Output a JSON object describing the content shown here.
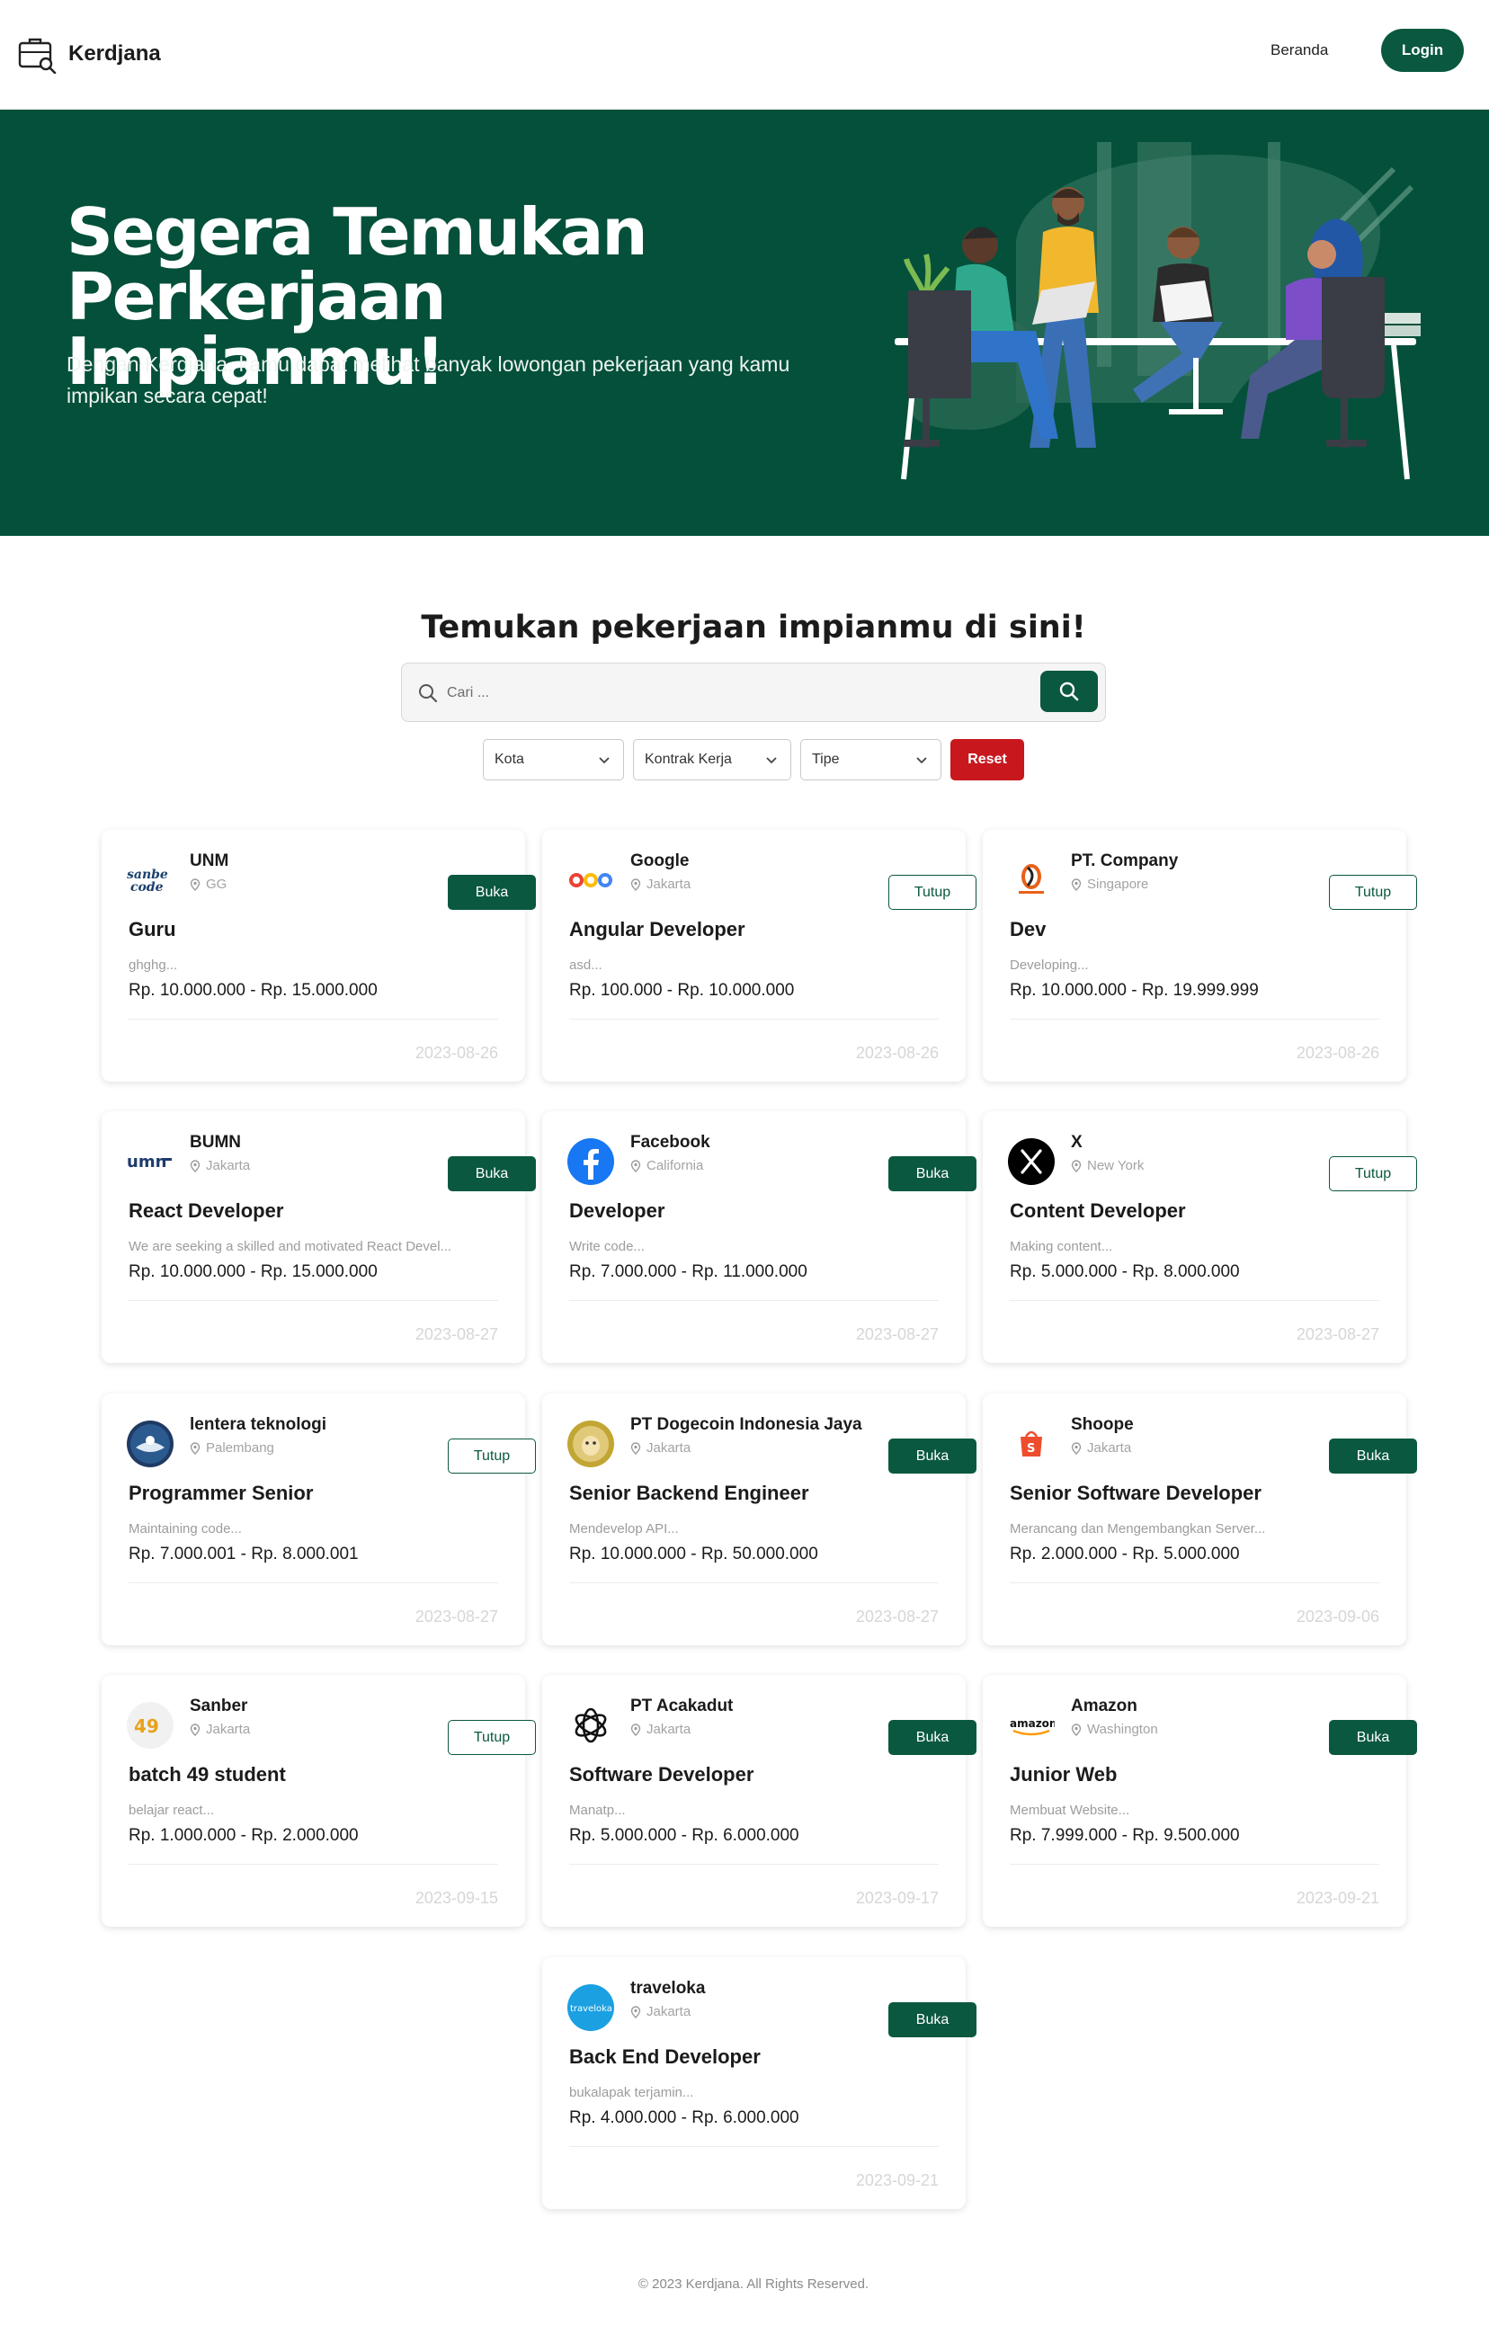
{
  "nav": {
    "brand": "Kerdjana",
    "home": "Beranda",
    "login": "Login"
  },
  "hero": {
    "title_line1": "Segera Temukan",
    "title_line2": "Perkerjaan Impianmu!",
    "subtitle": "Dengan Kerdjana, kamu dapat melihat banyak lowongan pekerjaan yang kamu impikan secara cepat!"
  },
  "search": {
    "heading": "Temukan pekerjaan impianmu di sini!",
    "placeholder": "Cari ...",
    "filters": [
      "Kota",
      "Kontrak Kerja",
      "Tipe"
    ],
    "reset": "Reset"
  },
  "colors": {
    "primary": "#0b5840",
    "hero_bg": "#04503a",
    "danger": "#c8181e"
  },
  "jobs": [
    {
      "company": "UNM",
      "location": "GG",
      "status": "Buka",
      "title": "Guru",
      "desc": "ghghg...",
      "salary": "Rp. 10.000.000 - Rp. 15.000.000",
      "date": "2023-08-26",
      "logo": "sanbercode-logo"
    },
    {
      "company": "Google",
      "location": "Jakarta",
      "status": "Tutup",
      "title": "Angular Developer",
      "desc": "asd...",
      "salary": "Rp. 100.000 - Rp. 10.000.000",
      "date": "2023-08-26",
      "logo": "google-logo"
    },
    {
      "company": "PT. Company",
      "location": "Singapore",
      "status": "Tutup",
      "title": "Dev",
      "desc": "Developing...",
      "salary": "Rp. 10.000.000 - Rp. 19.999.999",
      "date": "2023-08-26",
      "logo": "company-logo"
    },
    {
      "company": "BUMN",
      "location": "Jakarta",
      "status": "Buka",
      "title": "React Developer",
      "desc": "We are seeking a skilled and motivated React Devel...",
      "salary": "Rp. 10.000.000 - Rp. 15.000.000",
      "date": "2023-08-27",
      "logo": "umn-logo"
    },
    {
      "company": "Facebook",
      "location": "California",
      "status": "Buka",
      "title": "Developer",
      "desc": "Write code...",
      "salary": "Rp. 7.000.000 - Rp. 11.000.000",
      "date": "2023-08-27",
      "logo": "facebook-logo"
    },
    {
      "company": "X",
      "location": "New York",
      "status": "Tutup",
      "title": "Content Developer",
      "desc": "Making content...",
      "salary": "Rp. 5.000.000 - Rp. 8.000.000",
      "date": "2023-08-27",
      "logo": "x-logo"
    },
    {
      "company": "lentera teknologi",
      "location": "Palembang",
      "status": "Tutup",
      "title": "Programmer Senior",
      "desc": "Maintaining code...",
      "salary": "Rp. 7.000.001 - Rp. 8.000.001",
      "date": "2023-08-27",
      "logo": "lentera-logo"
    },
    {
      "company": "PT Dogecoin Indonesia Jaya",
      "location": "Jakarta",
      "status": "Buka",
      "title": "Senior Backend Engineer",
      "desc": "Mendevelop API...",
      "salary": "Rp. 10.000.000 - Rp. 50.000.000",
      "date": "2023-08-27",
      "logo": "dogecoin-logo"
    },
    {
      "company": "Shoope",
      "location": "Jakarta",
      "status": "Buka",
      "title": "Senior Software Developer",
      "desc": "Merancang dan Mengembangkan Server...",
      "salary": "Rp. 2.000.000 - Rp. 5.000.000",
      "date": "2023-09-06",
      "logo": "shopee-logo"
    },
    {
      "company": "Sanber",
      "location": "Jakarta",
      "status": "Tutup",
      "title": "batch 49 student",
      "desc": "belajar react...",
      "salary": "Rp. 1.000.000 - Rp. 2.000.000",
      "date": "2023-09-15",
      "logo": "sanber49-logo"
    },
    {
      "company": "PT Acakadut",
      "location": "Jakarta",
      "status": "Buka",
      "title": "Software Developer",
      "desc": "Manatp...",
      "salary": "Rp. 5.000.000 - Rp. 6.000.000",
      "date": "2023-09-17",
      "logo": "openai-logo"
    },
    {
      "company": "Amazon",
      "location": "Washington",
      "status": "Buka",
      "title": "Junior Web",
      "desc": "Membuat Website...",
      "salary": "Rp. 7.999.000 - Rp. 9.500.000",
      "date": "2023-09-21",
      "logo": "amazon-logo"
    },
    {
      "company": "traveloka",
      "location": "Jakarta",
      "status": "Buka",
      "title": "Back End Developer",
      "desc": "bukalapak terjamin...",
      "salary": "Rp. 4.000.000 - Rp. 6.000.000",
      "date": "2023-09-21",
      "logo": "traveloka-logo"
    }
  ],
  "footer": "© 2023 Kerdjana. All Rights Reserved."
}
